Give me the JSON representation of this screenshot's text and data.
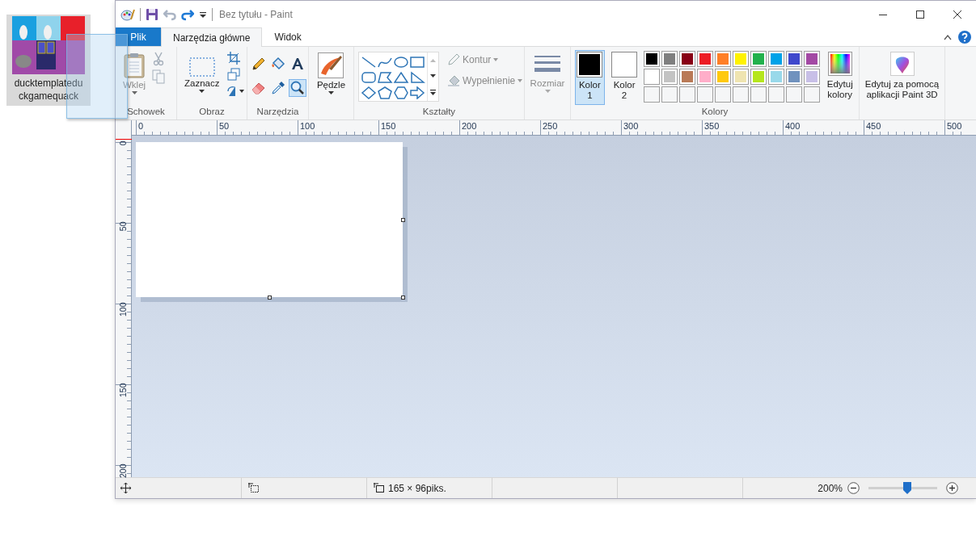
{
  "desktop_icon": {
    "label_lines": [
      "ducktemplatedu",
      "ckgamequack"
    ],
    "selected": true
  },
  "window": {
    "title": "Bez tytułu - Paint"
  },
  "quick_access": {
    "undo": {
      "disabled": true
    },
    "redo": {
      "disabled": false
    }
  },
  "tabs": [
    {
      "label": "Plik",
      "kind": "file",
      "selected": false
    },
    {
      "label": "Narzędzia główne",
      "kind": "tab",
      "selected": true
    },
    {
      "label": "Widok",
      "kind": "tab",
      "selected": false
    }
  ],
  "ribbon": {
    "clipboard": {
      "label": "Schowek",
      "paste": {
        "label": "Wklej",
        "disabled": true
      },
      "cut": {
        "disabled": true
      },
      "copy": {
        "disabled": true
      }
    },
    "image": {
      "label": "Obraz",
      "select": {
        "label": "Zaznacz"
      }
    },
    "tools": {
      "label": "Narzędzia",
      "items": [
        {
          "kind": "pencil",
          "selected": false
        },
        {
          "kind": "fill",
          "selected": false
        },
        {
          "kind": "text",
          "selected": false
        },
        {
          "kind": "eraser",
          "selected": false
        },
        {
          "kind": "picker",
          "selected": false
        },
        {
          "kind": "magnifier",
          "selected": true
        }
      ]
    },
    "brushes": {
      "label": "Pędzle"
    },
    "shapes": {
      "label": "Kształty",
      "outline": {
        "label": "Kontur",
        "disabled": true
      },
      "fill": {
        "label": "Wypełnienie",
        "disabled": true
      }
    },
    "size": {
      "label": "Rozmiar",
      "disabled": true
    },
    "colors": {
      "label": "Kolory",
      "current": [
        {
          "label": "Kolor",
          "number": "1",
          "color": "#000000",
          "selected": true
        },
        {
          "label": "Kolor",
          "number": "2",
          "color": "#ffffff",
          "selected": false
        }
      ],
      "palette": [
        {
          "color": "#000000"
        },
        {
          "color": "#7f7f7f"
        },
        {
          "color": "#880015"
        },
        {
          "color": "#ed1c24"
        },
        {
          "color": "#ff7f27"
        },
        {
          "color": "#fff200"
        },
        {
          "color": "#22b14c"
        },
        {
          "color": "#00a2e8"
        },
        {
          "color": "#3f48cc"
        },
        {
          "color": "#a349a4"
        },
        {
          "color": "#ffffff"
        },
        {
          "color": "#c3c3c3"
        },
        {
          "color": "#b97a57"
        },
        {
          "color": "#ffaec9"
        },
        {
          "color": "#ffc90e"
        },
        {
          "color": "#efe4b0"
        },
        {
          "color": "#b5e61d"
        },
        {
          "color": "#99d9ea"
        },
        {
          "color": "#7092be"
        },
        {
          "color": "#c8bfe7"
        }
      ],
      "edit": {
        "label": "Edytuj kolory"
      }
    },
    "paint3d": {
      "label": "Edytuj za pomocą aplikacji Paint 3D"
    }
  },
  "rulers": {
    "horizontal": [
      "0",
      "50",
      "100",
      "150",
      "200",
      "250",
      "300",
      "350",
      "400",
      "450",
      "500"
    ],
    "vertical": [
      "0",
      "50",
      "100",
      "150",
      "200"
    ]
  },
  "status_bar": {
    "image_size": "165 × 96piks.",
    "zoom": "200%",
    "zoom_slider": {
      "level": 0.56
    }
  }
}
